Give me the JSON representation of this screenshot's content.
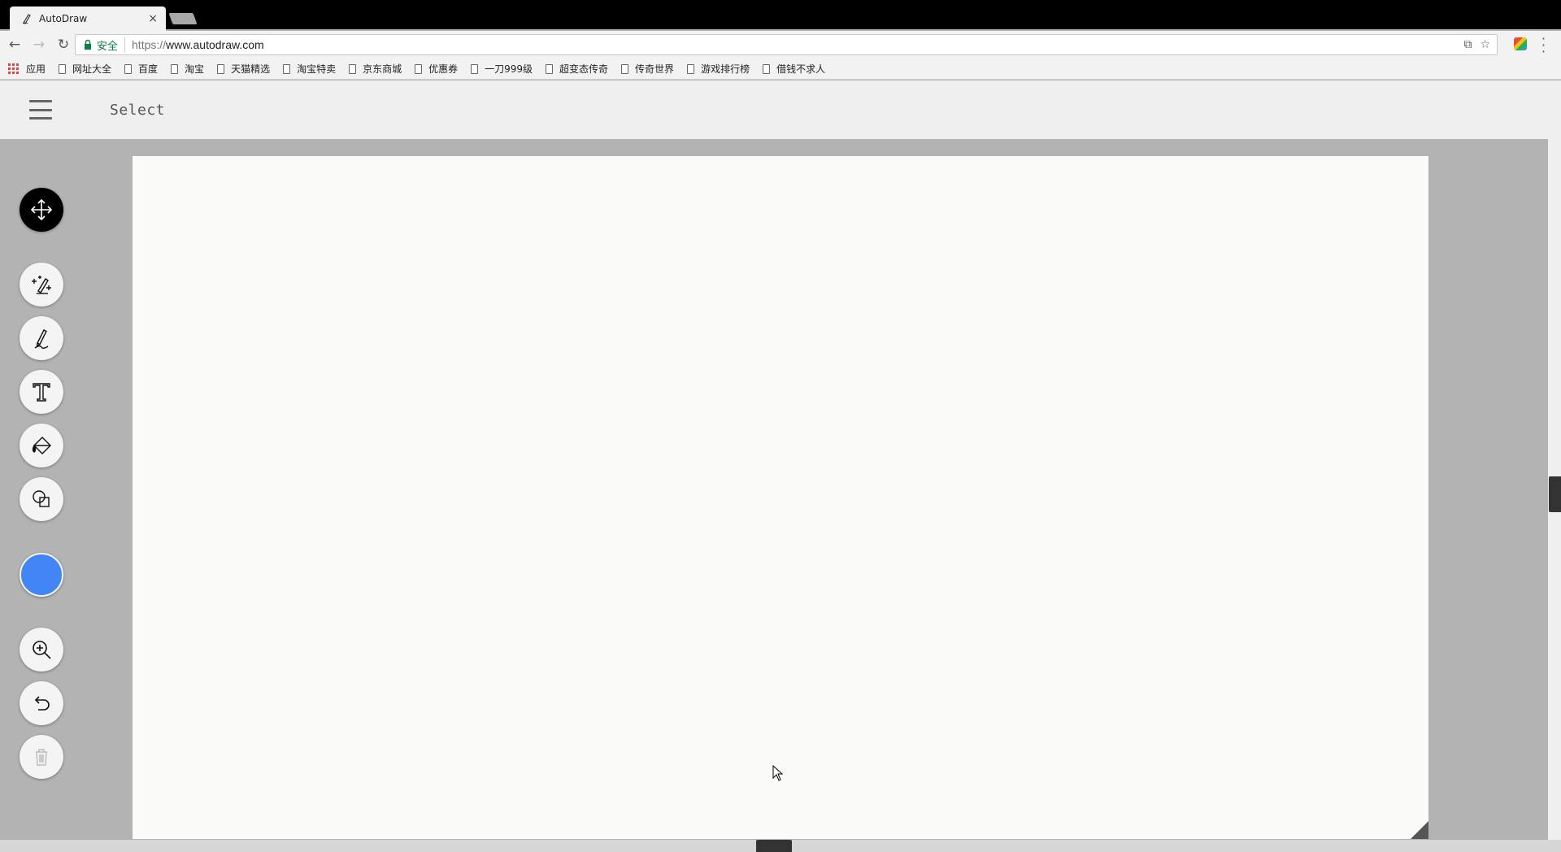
{
  "browser": {
    "tab_title": "AutoDraw",
    "tab_close": "×",
    "secure_label": "安全",
    "url_scheme": "https://",
    "url_host": "www.autodraw.com",
    "bookmarks": {
      "apps_label": "应用",
      "items": [
        "网址大全",
        "百度",
        "淘宝",
        "天猫精选",
        "淘宝特卖",
        "京东商城",
        "优惠券",
        "一刀999级",
        "超变态传奇",
        "传奇世界",
        "游戏排行榜",
        "借钱不求人"
      ]
    }
  },
  "app": {
    "mode_label": "Select",
    "tools": [
      {
        "name": "select-tool",
        "icon": "move-arrows-icon",
        "active": true
      },
      {
        "name": "autodraw-tool",
        "icon": "sparkle-pencil-icon",
        "active": false
      },
      {
        "name": "draw-tool",
        "icon": "pencil-icon",
        "active": false
      },
      {
        "name": "type-tool",
        "icon": "text-icon",
        "active": false
      },
      {
        "name": "fill-tool",
        "icon": "paint-bucket-icon",
        "active": false
      },
      {
        "name": "shape-tool",
        "icon": "shapes-icon",
        "active": false
      },
      {
        "name": "zoom-tool",
        "icon": "zoom-in-icon",
        "active": false
      },
      {
        "name": "undo-tool",
        "icon": "undo-icon",
        "active": false
      },
      {
        "name": "delete-tool",
        "icon": "trash-icon",
        "active": false
      }
    ],
    "selected_color": "#4285f4",
    "accent_active": "#000000"
  }
}
